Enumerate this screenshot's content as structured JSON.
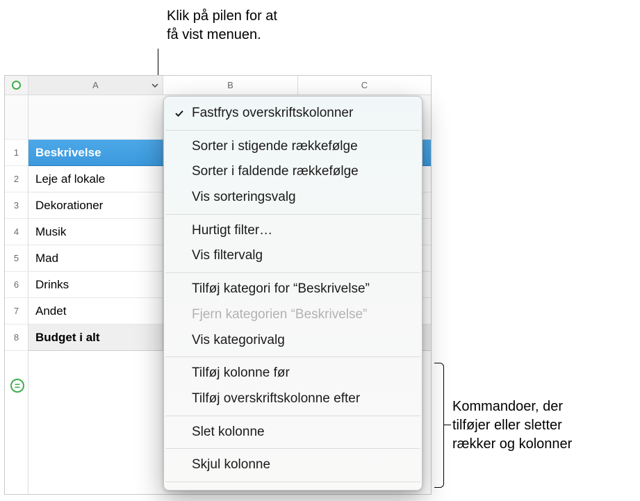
{
  "annotations": {
    "top": "Klik på pilen for at\nfå vist menuen.",
    "right": "Kommandoer, der\ntilføjer eller sletter\nrækker og kolonner"
  },
  "columns": {
    "A": "A",
    "B": "B",
    "C": "C"
  },
  "row_labels": [
    "1",
    "2",
    "3",
    "4",
    "5",
    "6",
    "7",
    "8"
  ],
  "table": {
    "header": [
      "Beskrivelse",
      "",
      ""
    ],
    "rows": [
      [
        "Leje af lokale",
        "",
        ""
      ],
      [
        "Dekorationer",
        "",
        ""
      ],
      [
        "Musik",
        "",
        ""
      ],
      [
        "Mad",
        "",
        ""
      ],
      [
        "Drinks",
        "",
        ""
      ],
      [
        "Andet",
        "",
        ""
      ]
    ],
    "footer": [
      "Budget i alt",
      "",
      ""
    ]
  },
  "menu": {
    "freeze": "Fastfrys overskriftskolonner",
    "sort_asc": "Sorter i stigende rækkefølge",
    "sort_desc": "Sorter i faldende rækkefølge",
    "show_sort": "Vis sorteringsvalg",
    "quick_filter": "Hurtigt filter…",
    "show_filter": "Vis filtervalg",
    "add_category": "Tilføj kategori for “Beskrivelse”",
    "remove_category": "Fjern kategorien “Beskrivelse”",
    "show_category": "Vis kategorivalg",
    "add_col_before": "Tilføj kolonne før",
    "add_header_col_after": "Tilføj overskriftskolonne efter",
    "delete_col": "Slet kolonne",
    "hide_col": "Skjul kolonne"
  }
}
